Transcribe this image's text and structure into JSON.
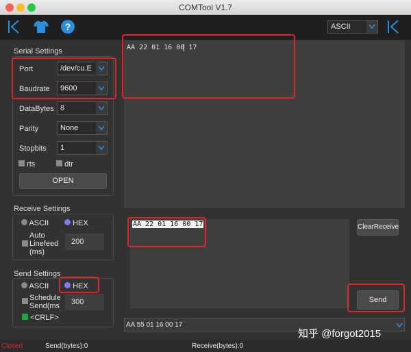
{
  "window": {
    "title": "COMTool V1.7"
  },
  "toolbar": {
    "encoding": "ASCII"
  },
  "serial": {
    "title": "Serial Settings",
    "port_label": "Port",
    "port_value": "/dev/cu.E",
    "baud_label": "Baudrate",
    "baud_value": "9600",
    "databytes_label": "DataBytes",
    "databytes_value": "8",
    "parity_label": "Parity",
    "parity_value": "None",
    "stopbits_label": "Stopbits",
    "stopbits_value": "1",
    "rts_label": "rts",
    "dtr_label": "dtr",
    "open_label": "OPEN"
  },
  "receive": {
    "title": "Receive Settings",
    "ascii_label": "ASCII",
    "hex_label": "HEX",
    "auto_linefeed_label": "Auto\nLinefeed\n(ms)",
    "linefeed_value": "200"
  },
  "send": {
    "title": "Send Settings",
    "ascii_label": "ASCII",
    "hex_label": "HEX",
    "scheduled_label": "Scheduled\nSend(ms)",
    "scheduled_value": "300",
    "crlf_label": "<CRLF>",
    "send_label": "Send",
    "clear_label": "ClearReceive"
  },
  "receive_area": {
    "text": "AA 22 01 16 00 17"
  },
  "send_area": {
    "text": "AA 22 01 16 00 17"
  },
  "history": {
    "text": "AA 55 01 16 00 17"
  },
  "status": {
    "state": "Closed",
    "send_bytes": "Send(bytes):0",
    "receive_bytes": "Receive(bytes):0"
  },
  "watermark": "知乎 @forgot2015",
  "colors": {
    "accent": "#2b8fe0",
    "red_highlight": "#e0252d",
    "radio_checked": "#7c7cf0",
    "crlf_green": "#1fa83a",
    "closed_red": "#e0252d"
  }
}
